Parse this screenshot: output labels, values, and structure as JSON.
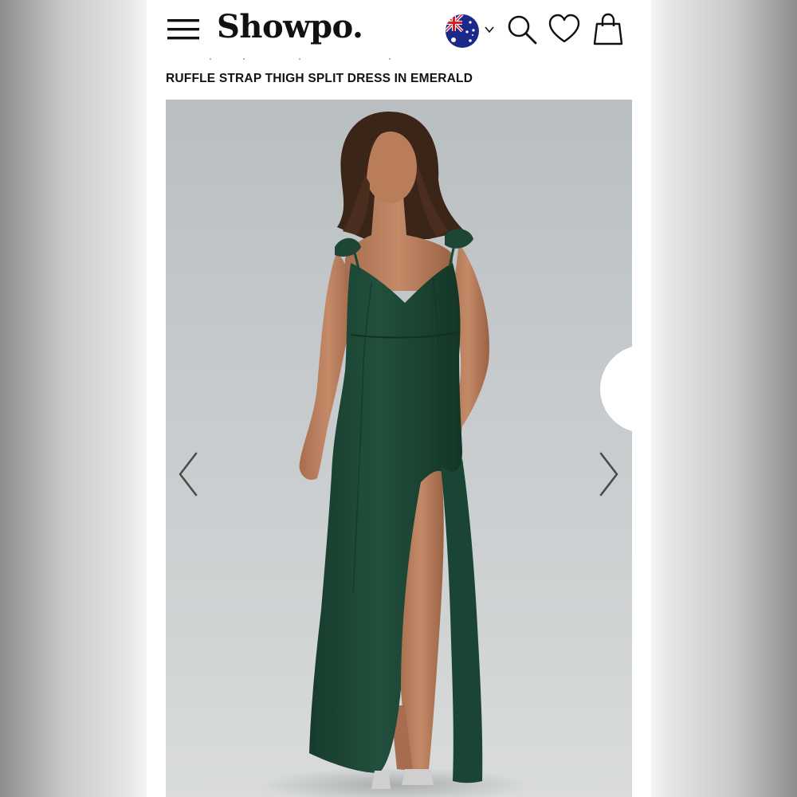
{
  "header": {
    "logo_text": "Showpo.",
    "menu_icon": "hamburger-menu-icon",
    "region_icon": "australia-flag-icon",
    "region_chevron_icon": "chevron-down-icon",
    "search_icon": "search-icon",
    "wishlist_icon": "heart-icon",
    "bag_icon": "shopping-bag-icon"
  },
  "product": {
    "title": "RUFFLE STRAP THIGH SPLIT DRESS IN EMERALD",
    "dress_color": "#1f4a38"
  },
  "gallery": {
    "prev_icon": "chevron-left-icon",
    "next_icon": "chevron-right-icon"
  },
  "colors": {
    "page_bg": "#ffffff",
    "text": "#111111",
    "backdrop": "#c9c9c9",
    "photo_bg": "#c6cacc"
  }
}
